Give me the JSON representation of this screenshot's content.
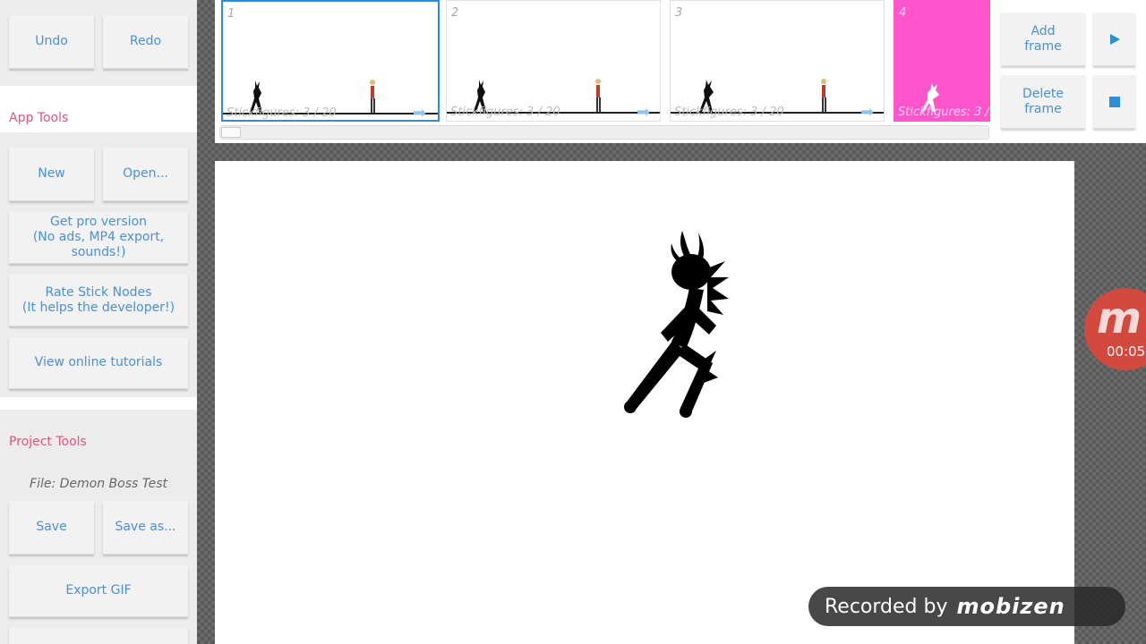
{
  "toolbar": {
    "undo": "Undo",
    "redo": "Redo"
  },
  "app_tools": {
    "title": "App Tools",
    "new": "New",
    "open": "Open...",
    "pro": "Get pro version\n(No ads, MP4 export, sounds!)",
    "rate": "Rate Stick Nodes\n(It helps the developer!)",
    "tutorials": "View online tutorials"
  },
  "project_tools": {
    "title": "Project Tools",
    "file": "File: Demon Boss Test",
    "save": "Save",
    "save_as": "Save as...",
    "export_gif": "Export GIF"
  },
  "frames": [
    {
      "number": "1",
      "info": "Stickfigures: 3 / 20",
      "selected": true
    },
    {
      "number": "2",
      "info": "Stickfigures: 3 / 20",
      "selected": false
    },
    {
      "number": "3",
      "info": "Stickfigures: 3 / 20",
      "selected": false
    },
    {
      "number": "4",
      "info": "Stickfigures: 3 /",
      "selected": false,
      "color": "#ff55cc"
    }
  ],
  "frame_actions": {
    "add": "Add\nframe",
    "delete": "Delete\nframe"
  },
  "playback": {
    "play_icon": "play-icon",
    "stop_icon": "stop-icon"
  },
  "recorder": {
    "bubble_letter": "m",
    "timer": "00:05",
    "recorded_by": "Recorded by",
    "brand": "mobizen"
  },
  "colors": {
    "accent_blue": "#4a90d9",
    "section_pink": "#e0557a",
    "selected_frame": "#2a8fd8",
    "frame4_bg": "#ff55cc",
    "recorder_red": "#d24a3e"
  }
}
